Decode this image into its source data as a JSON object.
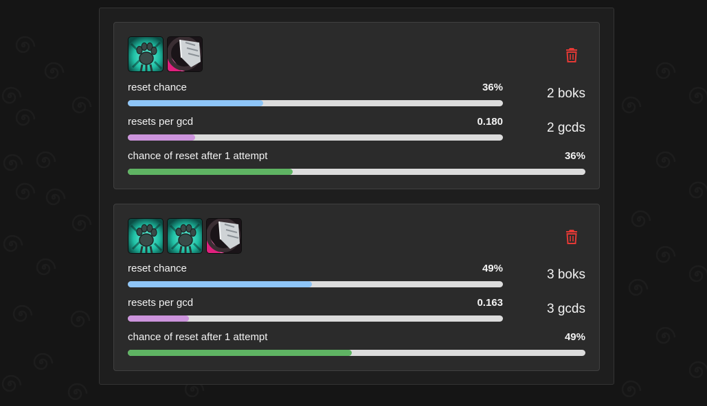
{
  "colors": {
    "reset_chance_bar": "#8ec5f7",
    "resets_per_gcd_bar": "#cc94dc",
    "attempt_bar": "#5fb463",
    "track": "#dcdcdc",
    "trash": "#e53935"
  },
  "cards": [
    {
      "icons": [
        "paw-spell-icon",
        "blade-spell-icon"
      ],
      "rows": [
        {
          "label": "reset chance",
          "value": "36%",
          "fraction": 0.36
        },
        {
          "label": "resets per gcd",
          "value": "0.180",
          "fraction": 0.18
        },
        {
          "label": "chance of reset after 1 attempt",
          "value": "36%",
          "fraction": 0.36
        }
      ],
      "side": {
        "boks": "2 boks",
        "gcds": "2 gcds"
      }
    },
    {
      "icons": [
        "paw-spell-icon",
        "paw-spell-icon",
        "blade-spell-icon"
      ],
      "rows": [
        {
          "label": "reset chance",
          "value": "49%",
          "fraction": 0.49
        },
        {
          "label": "resets per gcd",
          "value": "0.163",
          "fraction": 0.163
        },
        {
          "label": "chance of reset after 1 attempt",
          "value": "49%",
          "fraction": 0.49
        }
      ],
      "side": {
        "boks": "3 boks",
        "gcds": "3 gcds"
      }
    }
  ]
}
